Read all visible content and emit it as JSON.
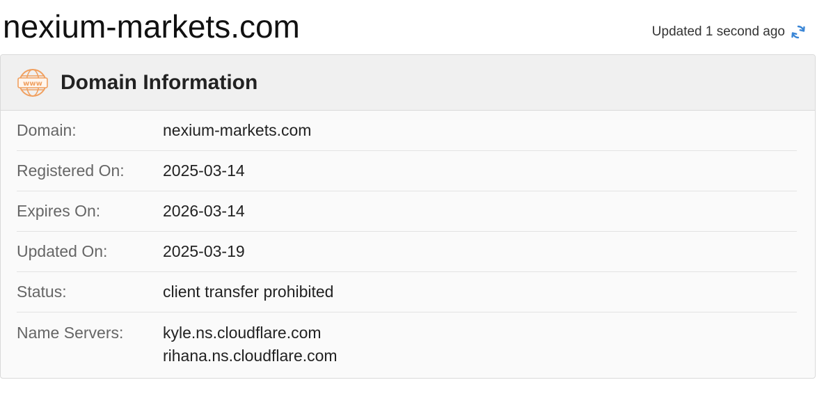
{
  "page": {
    "title": "nexium-markets.com",
    "updated_text": "Updated 1 second ago",
    "refresh_icon": "refresh-icon"
  },
  "card": {
    "icon": "www-globe-icon",
    "title": "Domain Information",
    "rows": [
      {
        "label": "Domain:",
        "value": "nexium-markets.com"
      },
      {
        "label": "Registered On:",
        "value": "2025-03-14"
      },
      {
        "label": "Expires On:",
        "value": "2026-03-14"
      },
      {
        "label": "Updated On:",
        "value": "2025-03-19"
      },
      {
        "label": "Status:",
        "value": "client transfer prohibited"
      },
      {
        "label": "Name Servers:",
        "values": [
          "kyle.ns.cloudflare.com",
          "rihana.ns.cloudflare.com"
        ]
      }
    ]
  },
  "colors": {
    "accent_icon": "#f0a060",
    "refresh": "#3a86d6"
  }
}
